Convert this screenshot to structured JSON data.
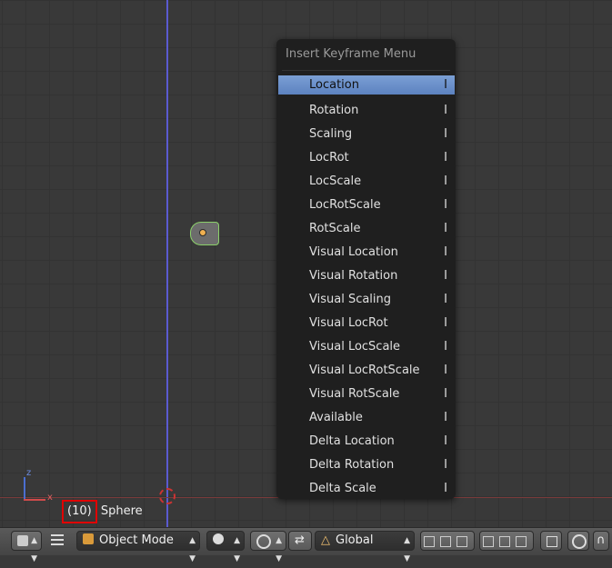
{
  "viewport": {
    "object_info_frame": "(10)",
    "object_info_name": "Sphere",
    "axis_z": "z",
    "axis_x": "x"
  },
  "menu": {
    "title": "Insert Keyframe Menu",
    "items": [
      {
        "label": "Location",
        "key": "I"
      },
      {
        "label": "Rotation",
        "key": "I"
      },
      {
        "label": "Scaling",
        "key": "I"
      },
      {
        "label": "LocRot",
        "key": "I"
      },
      {
        "label": "LocScale",
        "key": "I"
      },
      {
        "label": "LocRotScale",
        "key": "I"
      },
      {
        "label": "RotScale",
        "key": "I"
      },
      {
        "label": "Visual Location",
        "key": "I"
      },
      {
        "label": "Visual Rotation",
        "key": "I"
      },
      {
        "label": "Visual Scaling",
        "key": "I"
      },
      {
        "label": "Visual LocRot",
        "key": "I"
      },
      {
        "label": "Visual LocScale",
        "key": "I"
      },
      {
        "label": "Visual LocRotScale",
        "key": "I"
      },
      {
        "label": "Visual RotScale",
        "key": "I"
      },
      {
        "label": "Available",
        "key": "I"
      },
      {
        "label": "Delta Location",
        "key": "I"
      },
      {
        "label": "Delta Rotation",
        "key": "I"
      },
      {
        "label": "Delta Scale",
        "key": "I"
      }
    ]
  },
  "header": {
    "mode": "Object Mode",
    "orientation": "Global"
  },
  "colors": {
    "accent": "#5c82c0",
    "highlight_frame": "#e00000"
  }
}
